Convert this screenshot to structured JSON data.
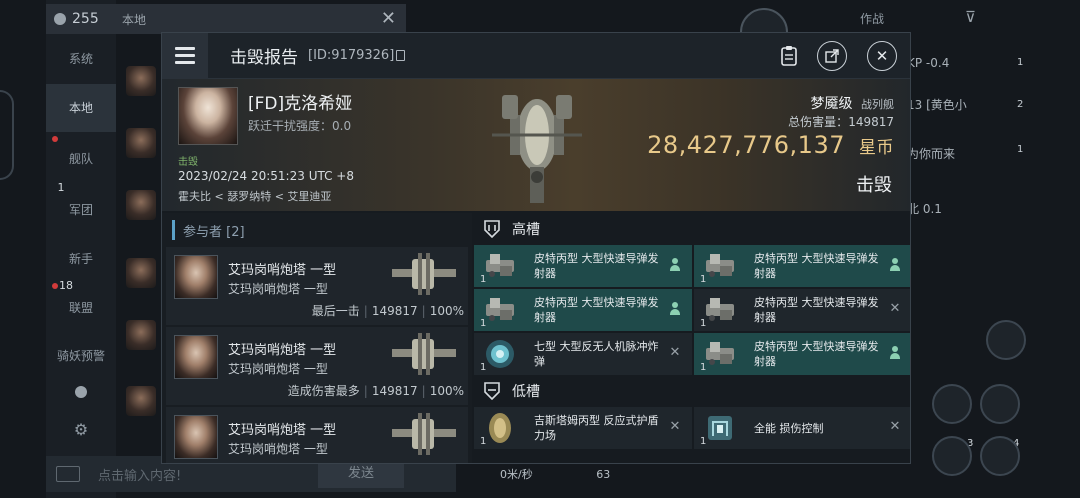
{
  "background": {
    "online_count": "255",
    "channel_title": "本地",
    "left_tabs": [
      "系统",
      "本地",
      "舰队",
      "军团",
      "新手",
      "联盟",
      "骑妖预警"
    ],
    "tab_badges": {
      "corp": "1",
      "alliance": "18"
    },
    "input_placeholder": "点击输入内容!",
    "send_label": "发送",
    "right_panel": {
      "tab_label": "作战",
      "line1": "KP -0.4",
      "line2": "13 [黄色小",
      "line3": "为你而来",
      "line4": "北 0.1",
      "badge1": "1",
      "badge2": "2",
      "badge3": "1",
      "bottom_a": "3",
      "bottom_b": "4"
    },
    "speed": "0米/秒",
    "speed_value": "63"
  },
  "modal": {
    "title": "击毁报告",
    "id": "[ID:9179326]",
    "victim": {
      "name": "[FD]克洛希娅",
      "sub": "跃迁干扰强度：0.0",
      "kill_tag": "击毁",
      "datetime": "2023/02/24 20:51:23 UTC +8",
      "location": "霍夫比 < 瑟罗纳特 < 艾里迪亚"
    },
    "ship": {
      "name": "梦魇级",
      "class": "战列舰",
      "damage_label": "总伤害量：",
      "damage_value": "149817",
      "isk_value": "28,427,776,137",
      "isk_unit": "星币",
      "status": "击毁"
    },
    "participants": {
      "header": "参与者 [2]",
      "rows": [
        {
          "name1": "艾玛岗哨炮塔 一型",
          "name2": "艾玛岗哨炮塔 一型",
          "tag": "最后一击",
          "damage": "149817",
          "pct": "100%"
        },
        {
          "name1": "艾玛岗哨炮塔 一型",
          "name2": "艾玛岗哨炮塔 一型",
          "tag": "造成伤害最多",
          "damage": "149817",
          "pct": "100%"
        },
        {
          "name1": "艾玛岗哨炮塔 一型",
          "name2": "艾玛岗哨炮塔 一型",
          "tag": "",
          "damage": "",
          "pct": ""
        }
      ]
    },
    "high_slots": {
      "header": "高槽",
      "items": [
        {
          "name": "皮特丙型 大型快速导弹发射器",
          "qty": "1",
          "state": "online",
          "icon": "launcher-icon"
        },
        {
          "name": "皮特丙型 大型快速导弹发射器",
          "qty": "1",
          "state": "online",
          "icon": "launcher-icon"
        },
        {
          "name": "皮特丙型 大型快速导弹发射器",
          "qty": "1",
          "state": "online",
          "icon": "launcher-icon"
        },
        {
          "name": "皮特丙型 大型快速导弹发射器",
          "qty": "1",
          "state": "destroyed",
          "icon": "launcher-icon"
        },
        {
          "name": "七型 大型反无人机脉冲炸弹",
          "qty": "1",
          "state": "destroyed",
          "icon": "smartbomb-icon"
        },
        {
          "name": "皮特丙型 大型快速导弹发射器",
          "qty": "1",
          "state": "online",
          "icon": "launcher-icon"
        }
      ]
    },
    "low_slots": {
      "header": "低槽",
      "items": [
        {
          "name": "吉斯塔姆丙型 反应式护盾力场",
          "qty": "1",
          "state": "destroyed",
          "icon": "hardener-icon"
        },
        {
          "name": "全能 损伤控制",
          "qty": "1",
          "state": "destroyed",
          "icon": "damage-control-icon"
        }
      ]
    }
  }
}
